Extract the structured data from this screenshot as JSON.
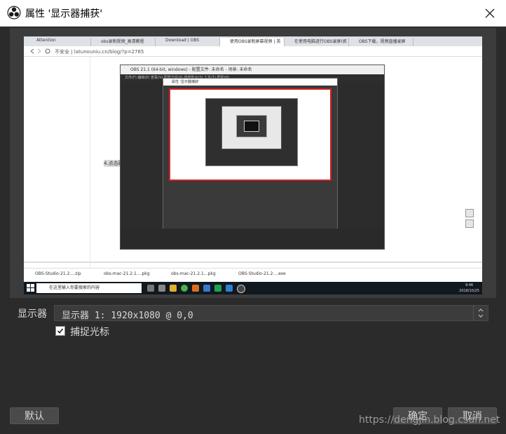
{
  "window": {
    "title": "属性 '显示器捕获'",
    "close_icon": "close-icon"
  },
  "preview": {
    "browser_tabs": [
      "Attention",
      "obs录制视频_高清教程",
      "Download | OBS",
      "使用OBS录制屏幕视频 | 英",
      "在使用电脑进行OBS录屏(抓",
      "OBS下载，视频直播录屏"
    ],
    "url": "不安全 | latunouniu.cn/blog/?p=2765",
    "page_label": "4.点击确定",
    "obs_title": "OBS 21.1 (64-bit, windows) - 配置文件: 未命名 - 场景: 未命名",
    "obs_menu": "文件(F)  编辑(E)  查看(V)  配置文件(P)  场景集合(S)  工具(T)  帮助(H)",
    "inner_title": "属性 '显示器捕获'",
    "downloads": [
      "OBS-Studio-21.2....zip",
      "obs-mac-21.2.1....pkg",
      "obs-mac-21.2.1...pkg",
      "OBS-Studio-21.2....exe"
    ],
    "taskbar_search": "在这里输入你要搜索的内容",
    "clock_time": "9:46",
    "clock_date": "2018/10/25"
  },
  "form": {
    "display_label": "显示器",
    "display_value": "显示器 1: 1920x1080 @ 0,0",
    "capture_cursor_label": "捕捉光标",
    "capture_cursor_checked": true
  },
  "buttons": {
    "defaults": "默认",
    "ok": "确定",
    "cancel": "取消"
  },
  "watermark": "https://dengjin.blog.csdn.net",
  "colors": {
    "background": "#2b2b2b",
    "text": "#d8d8d8",
    "button": "#4a4a4a"
  }
}
